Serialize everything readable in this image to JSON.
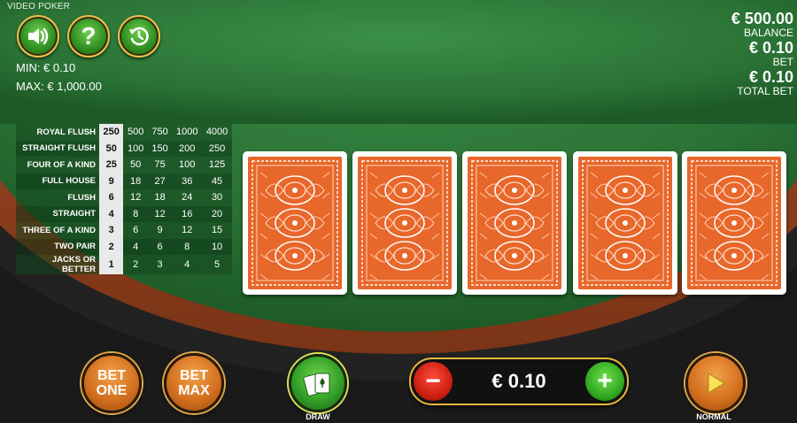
{
  "game": {
    "title": "VIDEO POKER"
  },
  "controls": {
    "sound_icon": "speaker-icon",
    "help_icon": "question-icon",
    "history_icon": "history-icon"
  },
  "limits": {
    "min_label": "MIN: € 0.10",
    "max_label": "MAX: € 1,000.00"
  },
  "info": {
    "balance_value": "€ 500.00",
    "balance_label": "BALANCE",
    "bet_value": "€ 0.10",
    "bet_label": "BET",
    "total_bet_value": "€ 0.10",
    "total_bet_label": "TOTAL BET"
  },
  "paytable": {
    "selected_column": 0,
    "rows": [
      {
        "hand": "ROYAL FLUSH",
        "payouts": [
          "250",
          "500",
          "750",
          "1000",
          "4000"
        ]
      },
      {
        "hand": "STRAIGHT FLUSH",
        "payouts": [
          "50",
          "100",
          "150",
          "200",
          "250"
        ]
      },
      {
        "hand": "FOUR OF A KIND",
        "payouts": [
          "25",
          "50",
          "75",
          "100",
          "125"
        ]
      },
      {
        "hand": "FULL HOUSE",
        "payouts": [
          "9",
          "18",
          "27",
          "36",
          "45"
        ]
      },
      {
        "hand": "FLUSH",
        "payouts": [
          "6",
          "12",
          "18",
          "24",
          "30"
        ]
      },
      {
        "hand": "STRAIGHT",
        "payouts": [
          "4",
          "8",
          "12",
          "16",
          "20"
        ]
      },
      {
        "hand": "THREE OF A KIND",
        "payouts": [
          "3",
          "6",
          "9",
          "12",
          "15"
        ]
      },
      {
        "hand": "TWO PAIR",
        "payouts": [
          "2",
          "4",
          "6",
          "8",
          "10"
        ]
      },
      {
        "hand": "JACKS OR BETTER",
        "payouts": [
          "1",
          "2",
          "3",
          "4",
          "5"
        ]
      }
    ]
  },
  "cards": [
    {
      "state": "face-down"
    },
    {
      "state": "face-down"
    },
    {
      "state": "face-down"
    },
    {
      "state": "face-down"
    },
    {
      "state": "face-down"
    }
  ],
  "buttons": {
    "bet_one_line1": "BET",
    "bet_one_line2": "ONE",
    "bet_max_line1": "BET",
    "bet_max_line2": "MAX",
    "draw_label": "DRAW",
    "bet_amount": "€ 0.10",
    "speed_label": "NORMAL"
  },
  "colors": {
    "felt": "#2f7a3a",
    "card_back": "#e8672a",
    "accent_gold": "#e7b93a"
  }
}
